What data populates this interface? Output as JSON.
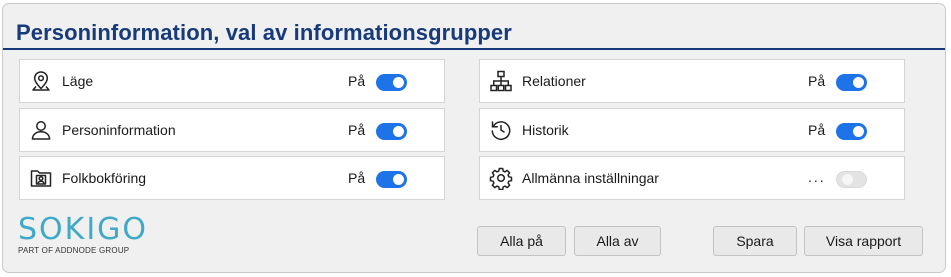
{
  "dialog": {
    "title": "Personinformation, val av informationsgrupper"
  },
  "groups": [
    {
      "label": "Läge",
      "state": "På",
      "icon": "location-pin-icon",
      "enabled": true
    },
    {
      "label": "Personinformation",
      "state": "På",
      "icon": "person-icon",
      "enabled": true
    },
    {
      "label": "Folkbokföring",
      "state": "På",
      "icon": "person-folder-icon",
      "enabled": true
    },
    {
      "label": "Relationer",
      "state": "På",
      "icon": "hierarchy-icon",
      "enabled": true
    },
    {
      "label": "Historik",
      "state": "På",
      "icon": "history-icon",
      "enabled": true
    },
    {
      "label": "Allmänna inställningar",
      "state": "...",
      "icon": "gear-icon",
      "enabled": false
    }
  ],
  "logo": {
    "name": "SOKIGO",
    "tagline": "PART OF ADDNODE GROUP"
  },
  "buttons": {
    "all_on": "Alla på",
    "all_off": "Alla av",
    "save": "Spara",
    "show_report": "Visa rapport"
  },
  "colors": {
    "title": "#163a7a",
    "toggle_on": "#1e73e8",
    "logo": "#3fa9c8"
  }
}
